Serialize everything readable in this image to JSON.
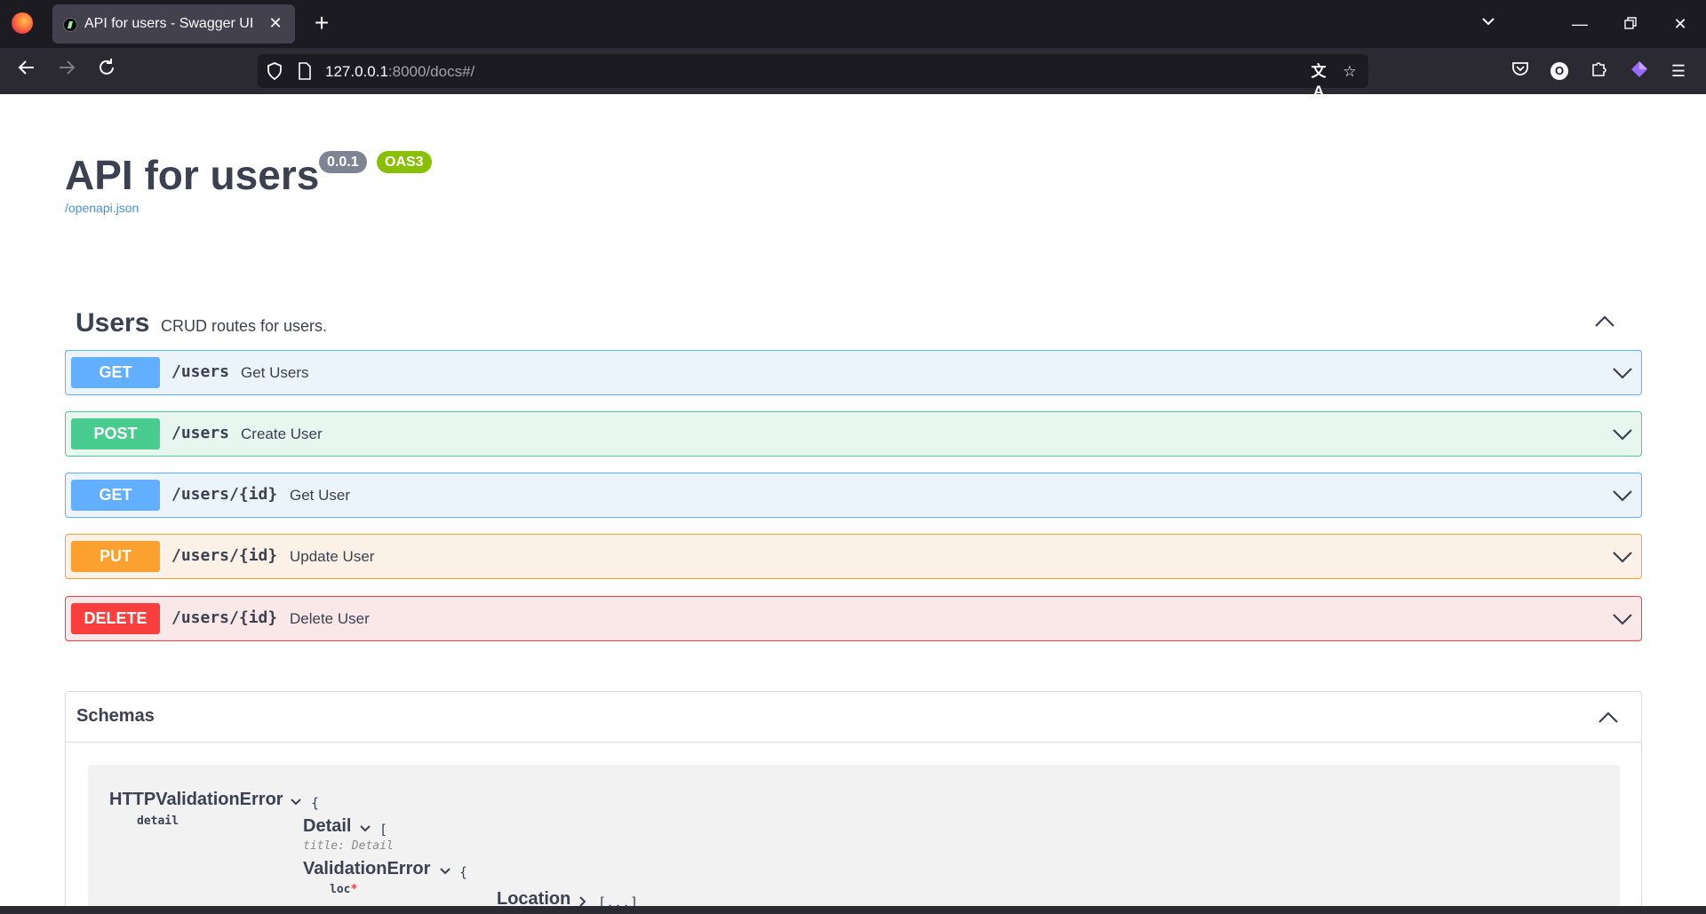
{
  "browser": {
    "tab_title": "API for users - Swagger UI",
    "url_host": "127.0.0.1",
    "url_rest": ":8000/docs#/",
    "profile_initial": "O"
  },
  "info": {
    "title": "API for users",
    "version": "0.0.1",
    "oas": "OAS3",
    "spec_link": "/openapi.json"
  },
  "tag": {
    "name": "Users",
    "description": "CRUD routes for users."
  },
  "operations": [
    {
      "method": "GET",
      "path": "/users",
      "summary": "Get Users"
    },
    {
      "method": "POST",
      "path": "/users",
      "summary": "Create User"
    },
    {
      "method": "GET",
      "path": "/users/{id}",
      "summary": "Get User"
    },
    {
      "method": "PUT",
      "path": "/users/{id}",
      "summary": "Update User"
    },
    {
      "method": "DELETE",
      "path": "/users/{id}",
      "summary": "Delete User"
    }
  ],
  "schemas": {
    "title": "Schemas",
    "model": {
      "name": "HTTPValidationError",
      "open_brace": "{",
      "prop": "detail",
      "detail_name": "Detail",
      "detail_bracket": "[",
      "detail_title": "title: Detail",
      "inner_name": "ValidationError",
      "inner_brace": "{",
      "inner_prop": "loc",
      "required_mark": "*",
      "location_name": "Location",
      "location_collapsed": "[...]"
    }
  },
  "colors": {
    "get": "#61affe",
    "post": "#49cc90",
    "put": "#fca130",
    "delete": "#f93e3e"
  }
}
